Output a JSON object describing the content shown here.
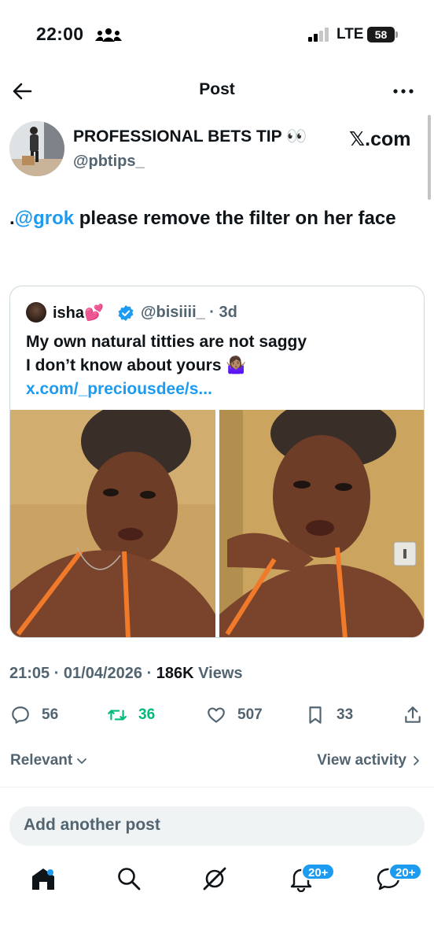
{
  "status_bar": {
    "time": "22:00",
    "network": "LTE",
    "battery": "58"
  },
  "header": {
    "title": "Post"
  },
  "post": {
    "author_name": "PROFESSIONAL BETS TIP 👀",
    "author_handle": "@pbtips_",
    "source_badge": "𝕏.com",
    "text_prefix": ".",
    "mention": "@grok",
    "text_body": " please remove the filter on her face",
    "timestamp": "21:05 · 01/04/2026 · ",
    "views_count": "186K",
    "views_label": " Views"
  },
  "quote": {
    "name": "isha💕",
    "handle_time": "@bisiiii_ · 3d",
    "text_line1": "My own natural titties are not saggy",
    "text_line2": "I don’t know about yours 🤷🏽‍♀️ ",
    "link": "x.com/_preciousdee/s..."
  },
  "actions": {
    "replies": "56",
    "reposts": "36",
    "likes": "507",
    "bookmarks": "33"
  },
  "sort": {
    "label": "Relevant",
    "view_activity": "View activity"
  },
  "composer": {
    "placeholder": "Add another post"
  },
  "tabbar": {
    "notifications_badge": "20+",
    "messages_badge": "20+"
  },
  "colors": {
    "accent": "#1d9bf0",
    "repost": "#00ba7c",
    "secondary_text": "#536471"
  }
}
